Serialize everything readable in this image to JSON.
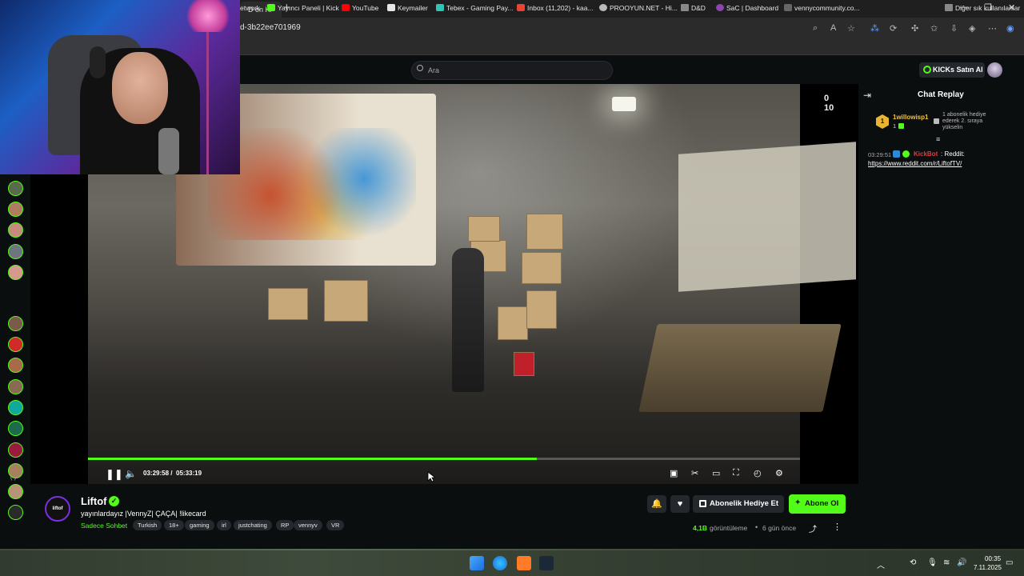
{
  "browser": {
    "tab_title": "D on Ki",
    "url": "d-3b22ee701969",
    "bookmarks": [
      {
        "label": "etwork",
        "color": "#444"
      },
      {
        "label": "Yayıncı Paneli | Kick",
        "color": "#53fc18"
      },
      {
        "label": "YouTube",
        "color": "#ff0000"
      },
      {
        "label": "Keymailer",
        "color": "#e8e8e8"
      },
      {
        "label": "Tebex - Gaming Pay...",
        "color": "#2ec4b6"
      },
      {
        "label": "Inbox (11,202) - kaa...",
        "color": "#ea4335"
      },
      {
        "label": "PROOYUN.NET - Hi...",
        "color": "#bbbbbb"
      },
      {
        "label": "D&D",
        "color": "#888888"
      },
      {
        "label": "SaC | Dashboard",
        "color": "#8e44ad"
      },
      {
        "label": "vennycommunity.co...",
        "color": "#666666"
      },
      {
        "label": "Diğer sık kullanılanlar",
        "color": "#888888"
      }
    ]
  },
  "header": {
    "search_placeholder": "Ara",
    "kicks_button": "KICKs Satın Al"
  },
  "player": {
    "time_current": "03:29:58",
    "time_separator": "/",
    "time_total": "05:33:19",
    "progress": 0.63,
    "hud_text": "0 10"
  },
  "chat": {
    "title": "Chat Replay",
    "pinned": {
      "rank": "1",
      "user": "1willowisp1",
      "count": "1",
      "text": "1 abonelik hediye ederek 2. sıraya yükselin"
    },
    "message": {
      "time": "03:29:51",
      "user": "KickBot",
      "colon": ":",
      "body": "Reddit:",
      "link": "https://www.reddit.com/r/LiftofTV/"
    }
  },
  "channel": {
    "avatar_text": "liftof",
    "name": "Liftof",
    "title": "yayınlardayız |VennyZ| ÇAÇA| !likecard",
    "category": "Sadece Sohbet",
    "tags": [
      "Turkish",
      "18+",
      "gaming",
      "irl",
      "justchating",
      "RP",
      "vennyv",
      "VR"
    ]
  },
  "actions": {
    "gift_button": "Abonelik Hediye Et",
    "subscribe_button": "Abone Ol",
    "views_count": "4,1B",
    "views_label": "görüntüleme",
    "separator": "•",
    "ago": "6 gün önce"
  },
  "taskbar": {
    "time": "00:35",
    "date": "7.11.2025"
  },
  "colors": {
    "accent": "#53fc18",
    "background": "#0b0e0f"
  }
}
